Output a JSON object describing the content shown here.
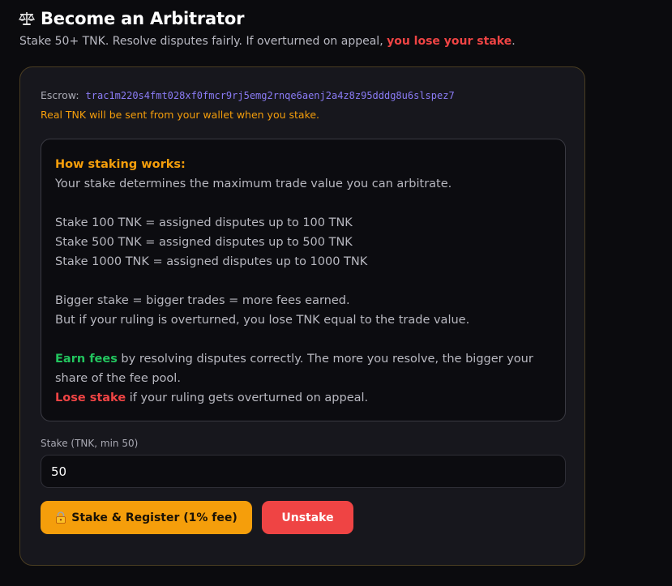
{
  "header": {
    "icon": "balance-scale-icon",
    "title": "Become an Arbitrator",
    "subtitle_prefix": "Stake 50+ TNK. Resolve disputes fairly. If overturned on appeal, ",
    "subtitle_warning": "you lose your stake",
    "subtitle_suffix": "."
  },
  "card": {
    "escrow_label": "Escrow:",
    "escrow_address": "trac1m220s4fmt028xf0fmcr9rj5emg2rnqe6aenj2a4z8z95dddg8u6slspez7",
    "real_note": "Real TNK will be sent from your wallet when you stake."
  },
  "info": {
    "title": "How staking works:",
    "intro": "Your stake determines the maximum trade value you can arbitrate.",
    "tiers": [
      "Stake 100 TNK = assigned disputes up to 100 TNK",
      "Stake 500 TNK = assigned disputes up to 500 TNK",
      "Stake 1000 TNK = assigned disputes up to 1000 TNK"
    ],
    "bigger": "Bigger stake = bigger trades = more fees earned.",
    "overturn": "But if your ruling is overturned, you lose TNK equal to the trade value.",
    "earn_label": "Earn fees",
    "earn_text_1": " by resolving disputes correctly. The more you resolve, the bigger your",
    "earn_text_2": "share of the fee pool.",
    "lose_label": "Lose stake",
    "lose_text": " if your ruling gets overturned on appeal."
  },
  "form": {
    "stake_label": "Stake (TNK, min 50)",
    "stake_value": "50",
    "stake_button": "Stake & Register (1% fee)",
    "stake_button_icon": "lock-icon",
    "unstake_button": "Unstake"
  },
  "colors": {
    "accent": "#f59e0b",
    "danger": "#ef4444",
    "success": "#22c55e",
    "address": "#8b7cf6"
  }
}
